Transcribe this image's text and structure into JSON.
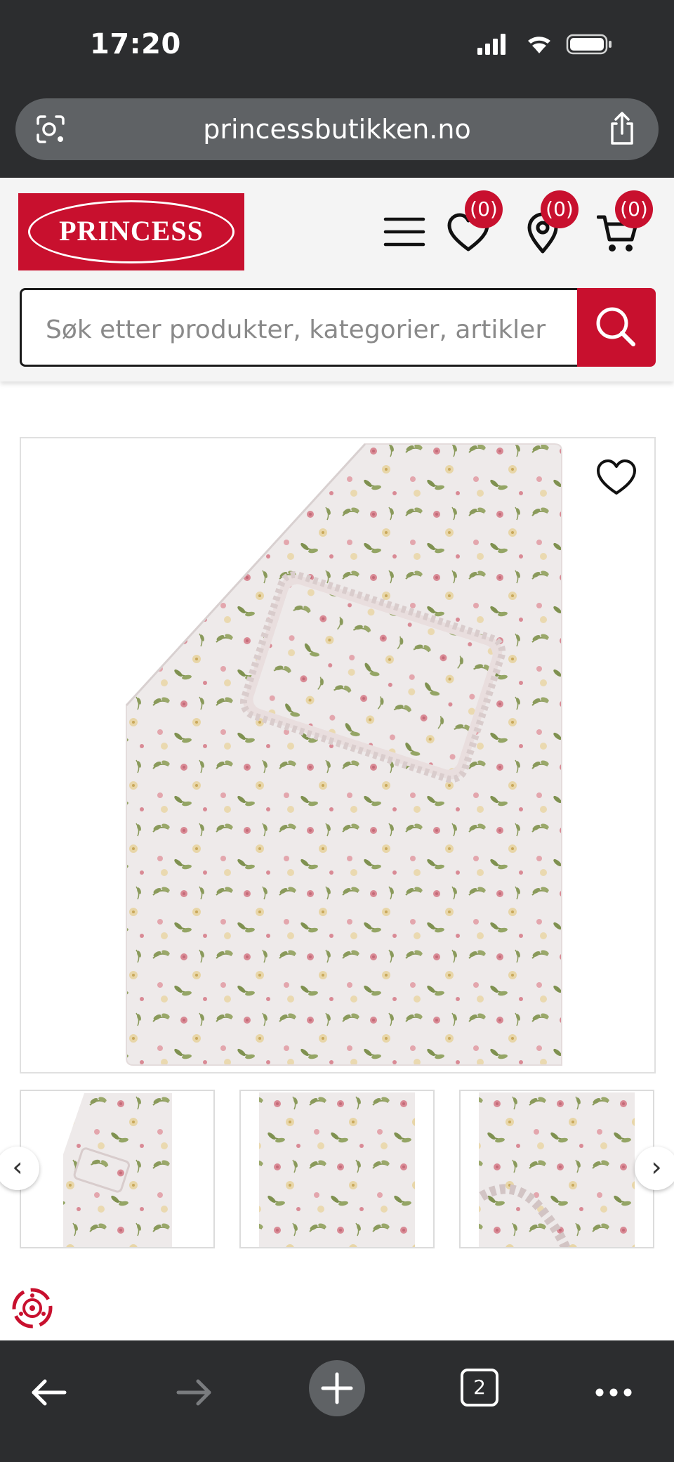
{
  "status_bar": {
    "time": "17:20",
    "icons": [
      "signal-icon",
      "wifi-icon",
      "battery-icon"
    ]
  },
  "browser": {
    "url": "princessbutikken.no",
    "tab_count": "2",
    "icons": [
      "lens-icon",
      "share-icon",
      "back-icon",
      "forward-icon",
      "new-tab-icon",
      "tabs-icon",
      "more-icon"
    ]
  },
  "header": {
    "logo_text": "PRINCESS",
    "brand_color": "#c8102e",
    "wishlist_count": "(0)",
    "store_count": "(0)",
    "cart_count": "(0)"
  },
  "search": {
    "placeholder": "Søk etter produkter, kategorier, artikler"
  },
  "gallery": {
    "main_image": "floral-duvet-set-image",
    "thumbnails": [
      "duvet-full-view",
      "fabric-pattern-closeup",
      "ruffle-pillow-closeup"
    ],
    "prev_arrow": "‹",
    "next_arrow": "›"
  }
}
